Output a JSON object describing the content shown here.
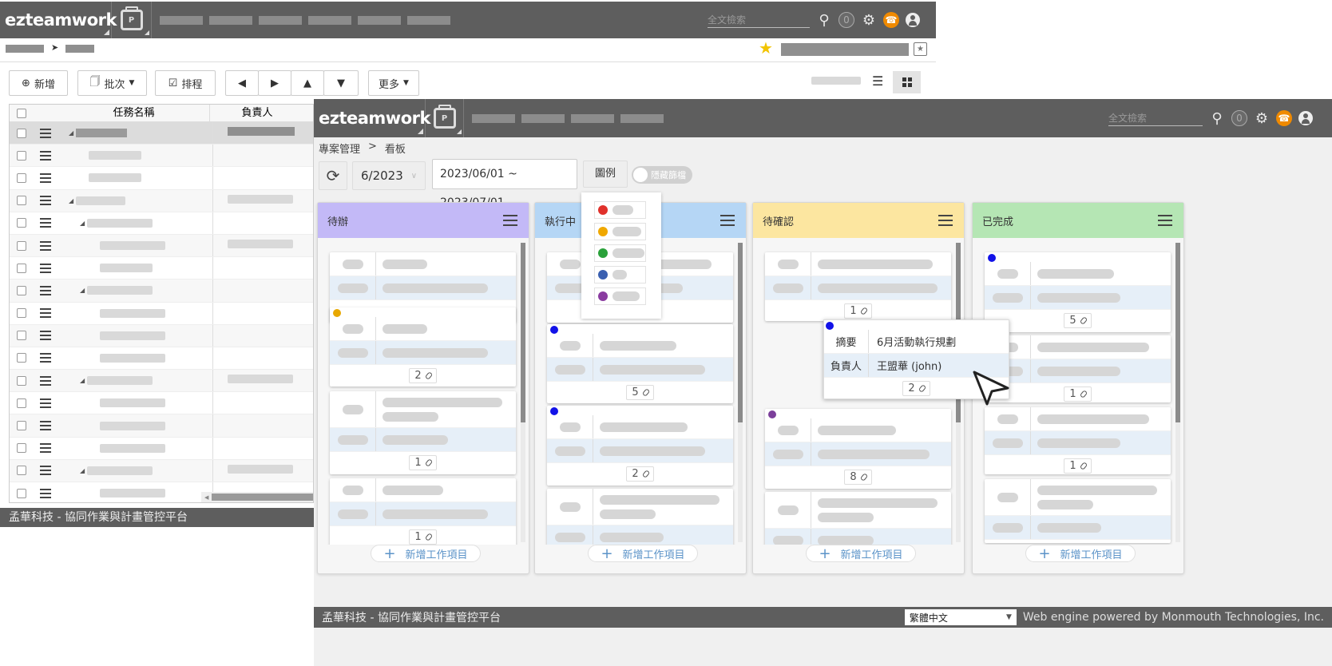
{
  "back": {
    "header": {
      "logo": "ezteamwork",
      "search_placeholder": "全文檢索",
      "notif_count": "0"
    },
    "toolbar": {
      "add": "新增",
      "batch": "批次",
      "schedule": "排程",
      "more": "更多"
    },
    "grid": {
      "col_name": "任務名稱",
      "col_owner": "負責人"
    },
    "footer": "孟華科技 - 協同作業與計畫管控平台"
  },
  "front": {
    "header": {
      "logo": "ezteamwork",
      "search_placeholder": "全文檢索",
      "notif_count": "0"
    },
    "breadcrumb": {
      "root": "專案管理",
      "sep": ">",
      "current": "看板"
    },
    "month": "6/2023",
    "date_range": "2023/06/01 ~ 2023/07/01",
    "legend_label": "圖例",
    "hide_toggle_label": "隱藏篩檔",
    "legend_colors": [
      "#e0312b",
      "#f0a800",
      "#2aa13a",
      "#3a5fb0",
      "#8a3ca0"
    ],
    "columns": [
      {
        "title": "待辦",
        "color": "#c3b9f7",
        "add_label": "新增工作項目",
        "counts": [
          "2",
          "1",
          "1"
        ]
      },
      {
        "title": "執行中",
        "color": "#b5d6f5",
        "add_label": "新增工作項目",
        "counts": [
          "5",
          "2"
        ]
      },
      {
        "title": "待確認",
        "color": "#fce6a0",
        "add_label": "新增工作項目",
        "counts": [
          "1",
          "8"
        ]
      },
      {
        "title": "已完成",
        "color": "#b5e6b4",
        "add_label": "新增工作項目",
        "counts": [
          "5",
          "1",
          "1"
        ]
      }
    ],
    "tooltip": {
      "summary_label": "摘要",
      "summary_value": "6月活動執行規劃",
      "owner_label": "負責人",
      "owner_value": "王盟華 (john)",
      "count": "2"
    },
    "footer": "孟華科技 - 協同作業與計畫管控平台",
    "language": "繁體中文",
    "powered_by": "Web engine powered by Monmouth Technologies, Inc."
  }
}
